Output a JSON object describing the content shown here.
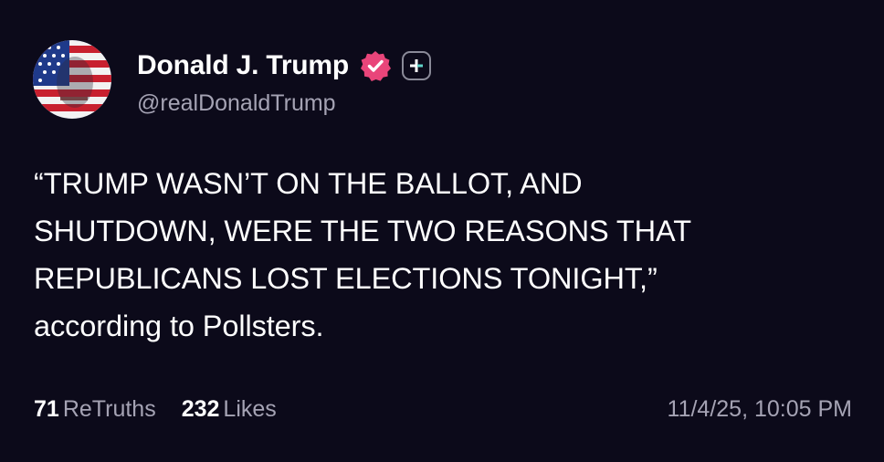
{
  "author": {
    "display_name": "Donald J. Trump",
    "handle": "@realDonaldTrump",
    "verified_icon": "verified-badge-icon",
    "verified_color": "#e9457a",
    "plus_icon": "plus-icon"
  },
  "post": {
    "lines": [
      "“TRUMP WASN’T ON THE BALLOT, AND",
      "SHUTDOWN, WERE THE TWO REASONS THAT",
      "REPUBLICANS LOST ELECTIONS TONIGHT,”",
      "according to Pollsters."
    ]
  },
  "stats": {
    "retruths_count": "71",
    "retruths_label": "ReTruths",
    "likes_count": "232",
    "likes_label": "Likes",
    "timestamp": "11/4/25, 10:05 PM"
  },
  "colors": {
    "background": "#0c0a1a",
    "secondary_text": "#a5a3b4",
    "primary_text": "#ffffff"
  }
}
